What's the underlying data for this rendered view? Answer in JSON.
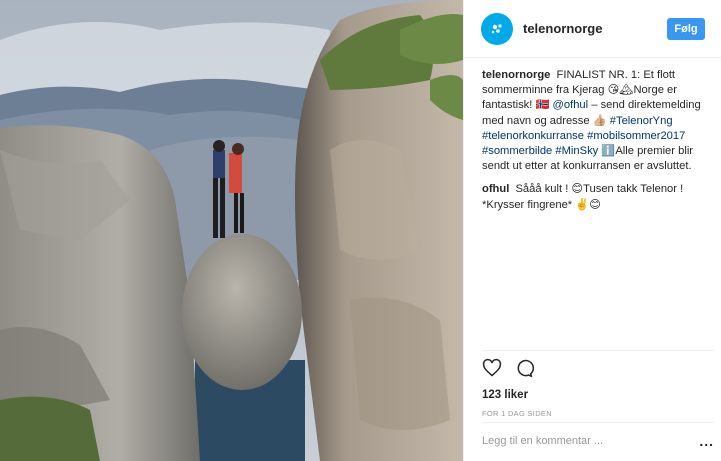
{
  "header": {
    "username": "telenornorge",
    "follow_label": "Følg",
    "avatar_icon": "telenor-logo-icon",
    "brand_color": "#00a9e8",
    "accent_color": "#3897f0"
  },
  "caption": {
    "username": "telenornorge",
    "text_1": "FINALIST NR. 1: Et flott sommerminne fra Kjerag 😘🏔Norge er fantastisk! 🇳🇴",
    "mention": "@ofhul",
    "text_2": " – send direktemelding med navn og adresse 👍🏼",
    "tags_1": "#TelenorYng #telenorkonkurranse #mobilsommer2017 #sommerbilde #MinSky",
    "text_3": " ℹ️Alle premier blir sendt ut etter at konkurransen er avsluttet."
  },
  "reply": {
    "username": "ofhul",
    "text": "Sååå kult ! 😊Tusen takk Telenor ! *Krysser fingrene* ✌️😊"
  },
  "actions": {
    "like_icon": "heart-icon",
    "comment_icon": "comment-icon",
    "likes": "123 liker",
    "time": "FOR 1 DAG SIDEN"
  },
  "add_comment": {
    "placeholder": "Legg til en kommentar ...",
    "more": "..."
  }
}
